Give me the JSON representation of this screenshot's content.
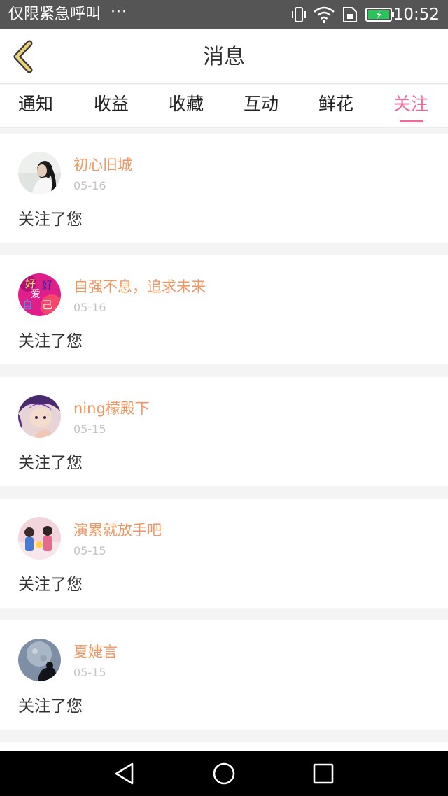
{
  "status_bar": {
    "carrier": "仅限紧急呼叫",
    "more": "···",
    "time": "10:52",
    "icons": [
      "vibrate-icon",
      "wifi-icon",
      "sim-icon",
      "battery-icon"
    ]
  },
  "header": {
    "title": "消息",
    "back_icon": "chevron-left-icon"
  },
  "tabs": [
    {
      "label": "通知"
    },
    {
      "label": "收益"
    },
    {
      "label": "收藏"
    },
    {
      "label": "互动"
    },
    {
      "label": "鲜花"
    },
    {
      "label": "关注",
      "active": true
    }
  ],
  "notifications": [
    {
      "name": "初心旧城",
      "date": "05-16",
      "message": "关注了您"
    },
    {
      "name": "自强不息，追求未来",
      "date": "05-16",
      "message": "关注了您"
    },
    {
      "name": "ning檬殿下",
      "date": "05-15",
      "message": "关注了您"
    },
    {
      "name": "演累就放手吧",
      "date": "05-15",
      "message": "关注了您"
    },
    {
      "name": "夏婕言",
      "date": "05-15",
      "message": "关注了您"
    }
  ],
  "avatar_text": {
    "line1": "好",
    "line2": "好",
    "line3": "爱",
    "line4": "自",
    "line5": "己"
  },
  "nav_bar": {
    "back_icon": "triangle-back-icon",
    "home_icon": "circle-home-icon",
    "recents_icon": "square-recents-icon"
  },
  "colors": {
    "accent": "#ef6b9a",
    "username": "#ee9762",
    "status_bar": "#555555",
    "nav_bar": "#000000",
    "back_arrow": "#c8b45a"
  }
}
